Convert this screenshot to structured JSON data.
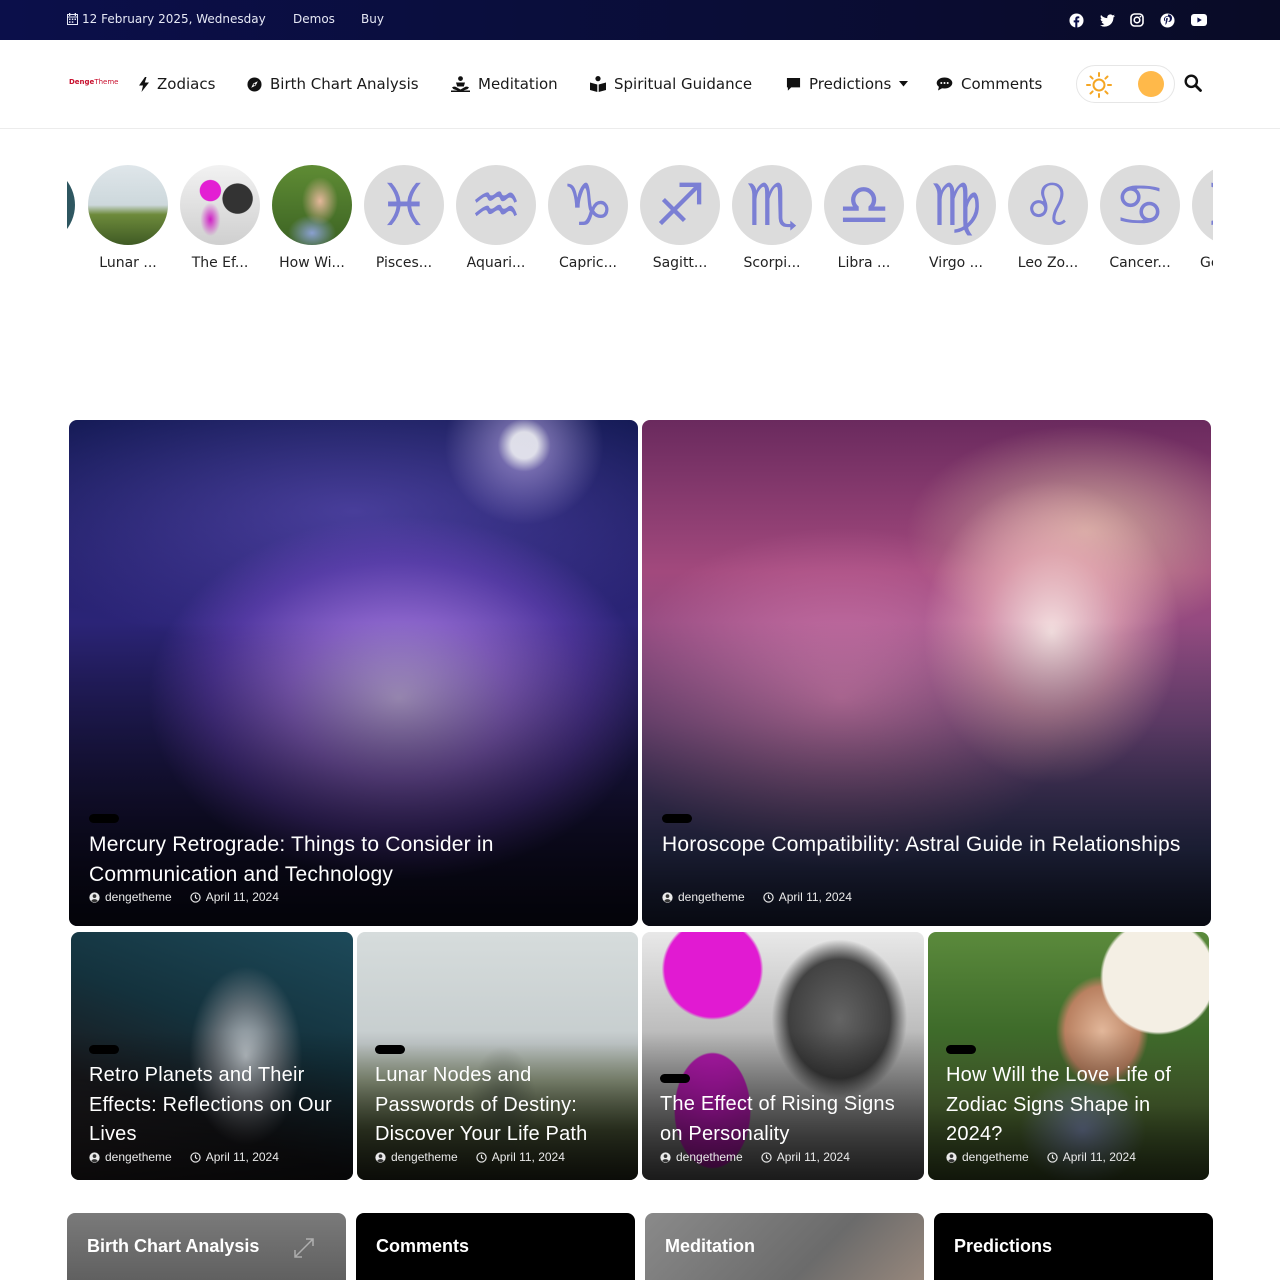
{
  "topbar": {
    "date": "12 February 2025, Wednesday",
    "links": [
      "Demos",
      "Buy"
    ],
    "social_icons": [
      "facebook-icon",
      "twitter-icon",
      "instagram-icon",
      "pinterest-icon",
      "youtube-icon"
    ]
  },
  "header": {
    "logo_bold": "Denge",
    "logo_light": "Theme",
    "nav": [
      {
        "label": "Zodiacs",
        "icon": "bolt-icon"
      },
      {
        "label": "Birth Chart Analysis",
        "icon": "compass-icon"
      },
      {
        "label": "Meditation",
        "icon": "meditation-icon"
      },
      {
        "label": "Spiritual Guidance",
        "icon": "book-reader-icon"
      },
      {
        "label": "Predictions",
        "icon": "comment-icon"
      },
      {
        "label": "Comments",
        "icon": "comments-icon"
      }
    ]
  },
  "stories": [
    {
      "label": "Lunar ..."
    },
    {
      "label": "The Ef..."
    },
    {
      "label": "How Wi..."
    },
    {
      "label": "Pisces...",
      "glyph": "♓"
    },
    {
      "label": "Aquari...",
      "glyph": "♒"
    },
    {
      "label": "Capric...",
      "glyph": "♑"
    },
    {
      "label": "Sagitt...",
      "glyph": "♐"
    },
    {
      "label": "Scorpi...",
      "glyph": "♏"
    },
    {
      "label": "Libra ...",
      "glyph": "♎"
    },
    {
      "label": "Virgo ...",
      "glyph": "♍"
    },
    {
      "label": "Leo Zo...",
      "glyph": "♌"
    },
    {
      "label": "Cancer...",
      "glyph": "♋"
    },
    {
      "label": "Ge",
      "glyph": "♊"
    }
  ],
  "posts": [
    {
      "title": "Mercury Retrograde: Things to Consider in Communication and Technology",
      "author": "dengetheme",
      "date": "April 11, 2024"
    },
    {
      "title": "Horoscope Compatibility: Astral Guide in Relationships",
      "author": "dengetheme",
      "date": "April 11, 2024"
    },
    {
      "title": "Retro Planets and Their Effects: Reflections on Our Lives",
      "author": "dengetheme",
      "date": "April 11, 2024"
    },
    {
      "title": "Lunar Nodes and Passwords of Destiny: Discover Your Life Path",
      "author": "dengetheme",
      "date": "April 11, 2024"
    },
    {
      "title": "The Effect of Rising Signs on Personality",
      "author": "dengetheme",
      "date": "April 11, 2024"
    },
    {
      "title": "How Will the Love Life of Zodiac Signs Shape in 2024?",
      "author": "dengetheme",
      "date": "April 11, 2024"
    }
  ],
  "categories": [
    {
      "label": "Birth Chart Analysis"
    },
    {
      "label": "Comments"
    },
    {
      "label": "Meditation"
    },
    {
      "label": "Predictions"
    }
  ],
  "colors": {
    "topbar": "#0b0f4a",
    "logo": "#c8102e",
    "zodiac_glyph": "#7b7fd4",
    "toggle_knob": "#ffb94a"
  }
}
